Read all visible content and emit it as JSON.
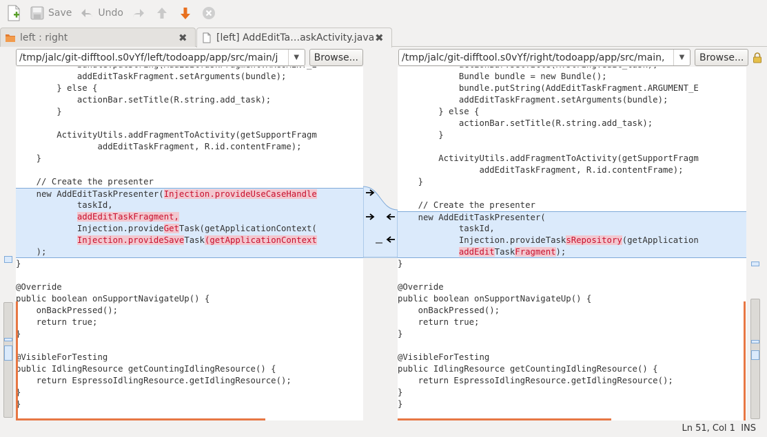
{
  "toolbar": {
    "new_icon": "new-file-icon",
    "save_label": "Save",
    "undo_label": "Undo"
  },
  "tabs": [
    {
      "label": "left : right",
      "icon": "folder-icon"
    },
    {
      "label": "[left] AddEditTa…askActivity.java",
      "icon": "document-icon"
    }
  ],
  "left": {
    "path": "/tmp/jalc/git-difftool.s0vYf/left/todoapp/app/src/main/j",
    "browse_label": "Browse..."
  },
  "right": {
    "path": "/tmp/jalc/git-difftool.s0vYf/right/todoapp/app/src/main,",
    "browse_label": "Browse..."
  },
  "status": {
    "position": "Ln 51, Col 1",
    "mode": "INS"
  },
  "colors": {
    "chunk": "#dbeafb",
    "highlight": "#f2c7cf",
    "accent": "#e77744"
  }
}
